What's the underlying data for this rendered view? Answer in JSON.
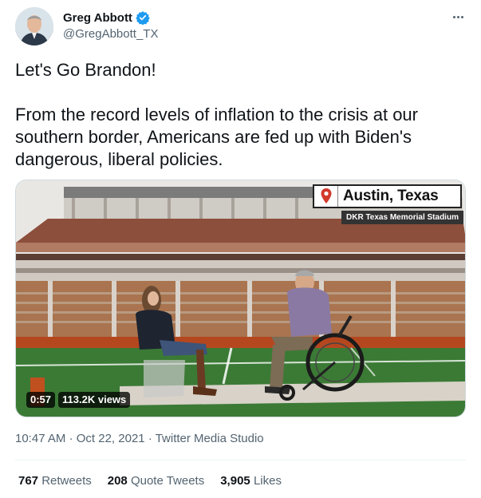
{
  "author": {
    "display_name": "Greg Abbott",
    "handle": "@GregAbbott_TX",
    "verified": true
  },
  "tweet": {
    "line1": "Let's Go Brandon!",
    "line2": "From the record levels of inflation to the crisis at our southern border, Americans are fed up with Biden's dangerous, liberal policies."
  },
  "media": {
    "location_title": "Austin, Texas",
    "location_subtitle": "DKR Texas Memorial Stadium",
    "duration": "0:57",
    "views": "113.2K views"
  },
  "meta": {
    "time": "10:47 AM",
    "date": "Oct 22, 2021",
    "source": "Twitter Media Studio",
    "separator": "·"
  },
  "stats": {
    "retweets_count": "767",
    "retweets_label": "Retweets",
    "quotes_count": "208",
    "quotes_label": "Quote Tweets",
    "likes_count": "3,905",
    "likes_label": "Likes"
  },
  "colors": {
    "accent": "#1d9bf0",
    "text_primary": "#0f1419",
    "text_secondary": "#536471",
    "divider": "#eff3f4"
  }
}
